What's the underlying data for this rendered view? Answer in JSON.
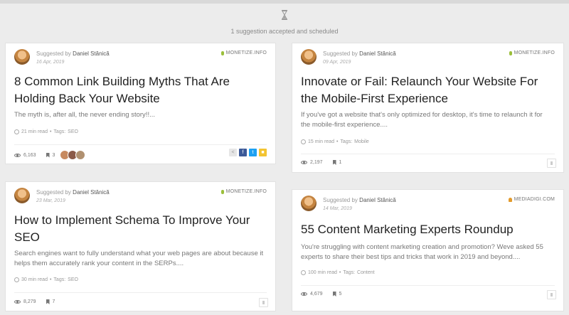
{
  "notice": {
    "message": "1 suggestion accepted and scheduled"
  },
  "cards": [
    {
      "suggested_prefix": "Suggested by",
      "author": "Daniel Stănică",
      "date": "16 Apr, 2019",
      "source": "MONETIZE.INFO",
      "title_lines": [
        "8 Common Link Building Myths That Are",
        "Holding Back Your Website"
      ],
      "description_lines": [
        "The myth is, after all, the never ending story!!..."
      ],
      "read_time": "21 min read",
      "tags_label": "Tags:",
      "tag": "SEO",
      "views": "6,163",
      "saves": "3"
    },
    {
      "suggested_prefix": "Suggested by",
      "author": "Daniel Stănică",
      "date": "09 Apr, 2019",
      "source": "MONETIZE.INFO",
      "title_lines": [
        "Innovate or Fail: Relaunch Your Website For",
        "the Mobile-First Experience"
      ],
      "description_lines": [
        "If you've got a website that's only optimized for desktop, it's time to relaunch it for",
        "the mobile-first experience...."
      ],
      "read_time": "15 min read",
      "tags_label": "Tags:",
      "tag": "Mobile",
      "views": "2,197",
      "saves": "1"
    },
    {
      "suggested_prefix": "Suggested by",
      "author": "Daniel Stănică",
      "date": "23 Mar, 2019",
      "source": "MONETIZE.INFO",
      "title_lines": [
        "How to Implement Schema To Improve Your",
        "SEO"
      ],
      "description_lines": [
        "Search engines want to fully understand what your web pages are about because it",
        "helps them accurately rank your content in the SERPs...."
      ],
      "read_time": "30 min read",
      "tags_label": "Tags:",
      "tag": "SEO",
      "views": "8,279",
      "saves": "7"
    },
    {
      "suggested_prefix": "Suggested by",
      "author": "Daniel Stănică",
      "date": "14 Mar, 2019",
      "source": "MEDIADIGI.COM",
      "title_lines": [
        "55 Content Marketing Experts Roundup"
      ],
      "description_lines": [
        "You're struggling with content marketing creation and promotion? Weve asked 55",
        "experts to share their best tips and tricks that work in 2019 and beyond...."
      ],
      "read_time": "100 min read",
      "tags_label": "Tags:",
      "tag": "Content",
      "views": "4,679",
      "saves": "5"
    }
  ],
  "icons": {
    "hourglass": "hourglass-icon",
    "share": "share-icon",
    "facebook": "facebook-icon",
    "twitter": "twitter-icon",
    "buffer": "yellow-share-icon"
  }
}
